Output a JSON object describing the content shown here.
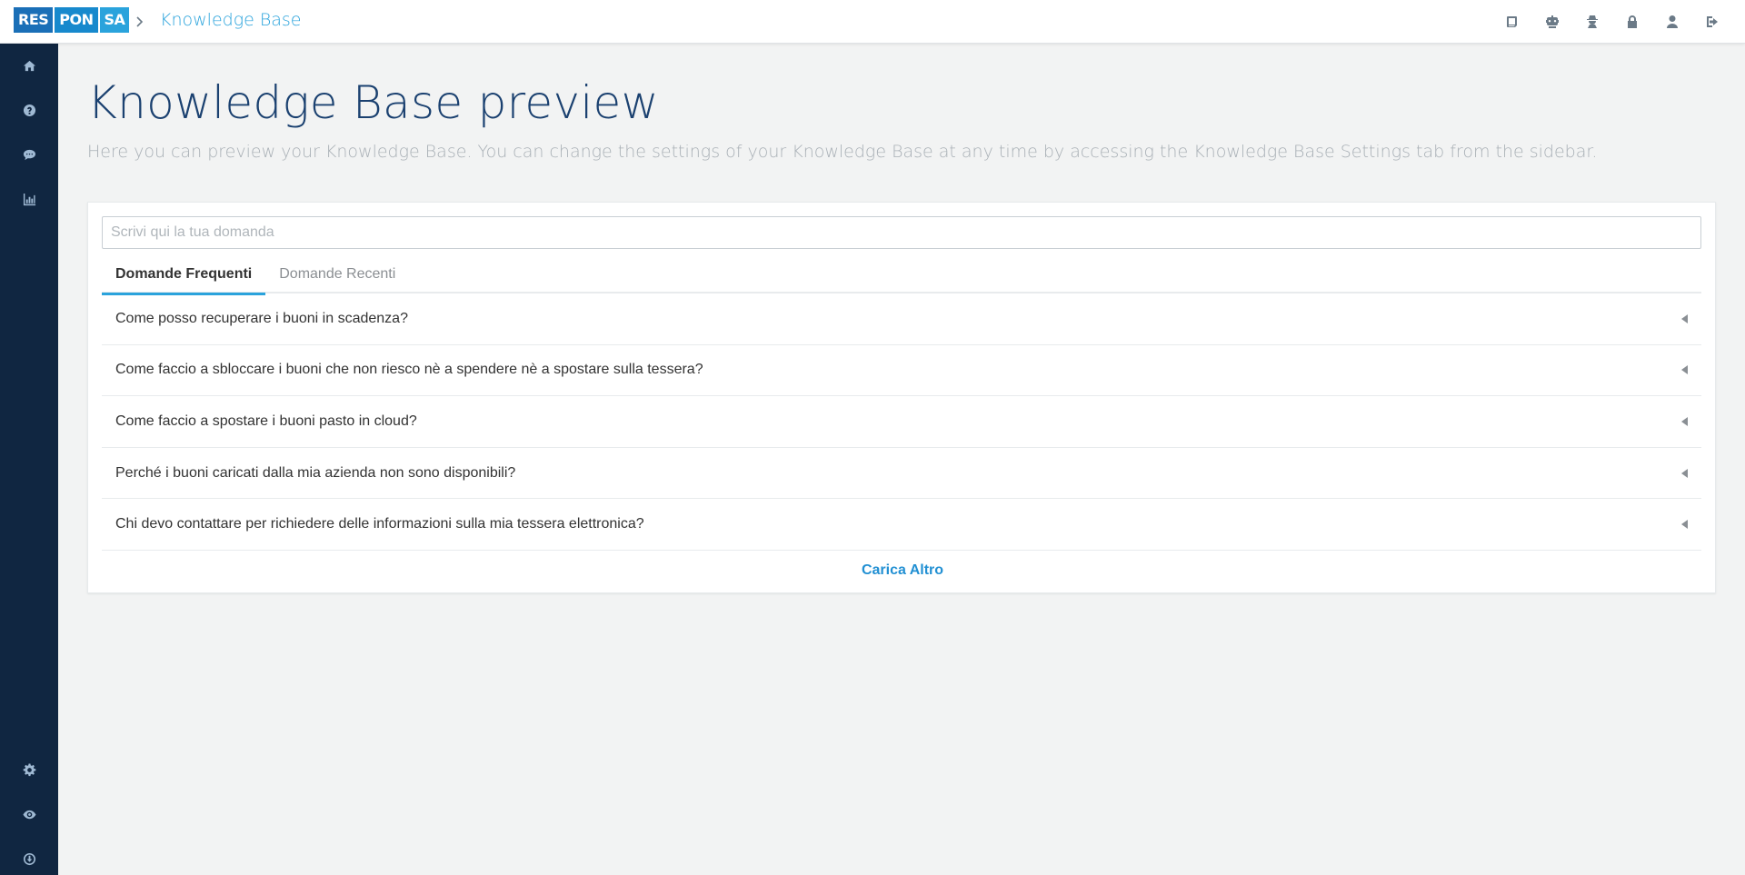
{
  "app": {
    "logo_parts": [
      "RES",
      "PON",
      "SA"
    ],
    "brand_colors": [
      "#1a6fb7",
      "#1789cd",
      "#2aa3dc"
    ],
    "breadcrumb": "Knowledge Base"
  },
  "topbar": {
    "icons": [
      "book-icon",
      "robot-icon",
      "user-secret-icon",
      "lock-icon",
      "user-icon",
      "sign-out-icon"
    ]
  },
  "sidebar": {
    "top_items": [
      "home-icon",
      "question-circle-icon",
      "comments-icon",
      "bar-chart-icon"
    ],
    "bottom_items": [
      "gear-icon",
      "eye-icon",
      "download-circle-icon"
    ],
    "background": "#102641"
  },
  "page": {
    "title": "Knowledge Base preview",
    "subtitle": "Here you can preview your Knowledge Base. You can change the settings of your Knowledge Base at any time by accessing the Knowledge Base Settings tab from the sidebar."
  },
  "kb": {
    "search_placeholder": "Scrivi qui la tua domanda",
    "search_value": "",
    "tabs": [
      {
        "label": "Domande Frequenti",
        "active": true
      },
      {
        "label": "Domande Recenti",
        "active": false
      }
    ],
    "questions": [
      "Come posso recuperare i buoni in scadenza?",
      "Come faccio a sbloccare i buoni che non riesco nè a spendere nè a spostare sulla tessera?",
      "Come faccio a spostare i buoni pasto in cloud?",
      "Perché i buoni caricati dalla mia azienda non sono disponibili?",
      "Chi devo contattare per richiedere delle informazioni sulla mia tessera elettronica?"
    ],
    "load_more": "Carica Altro",
    "accent": "#2aa3dc"
  }
}
